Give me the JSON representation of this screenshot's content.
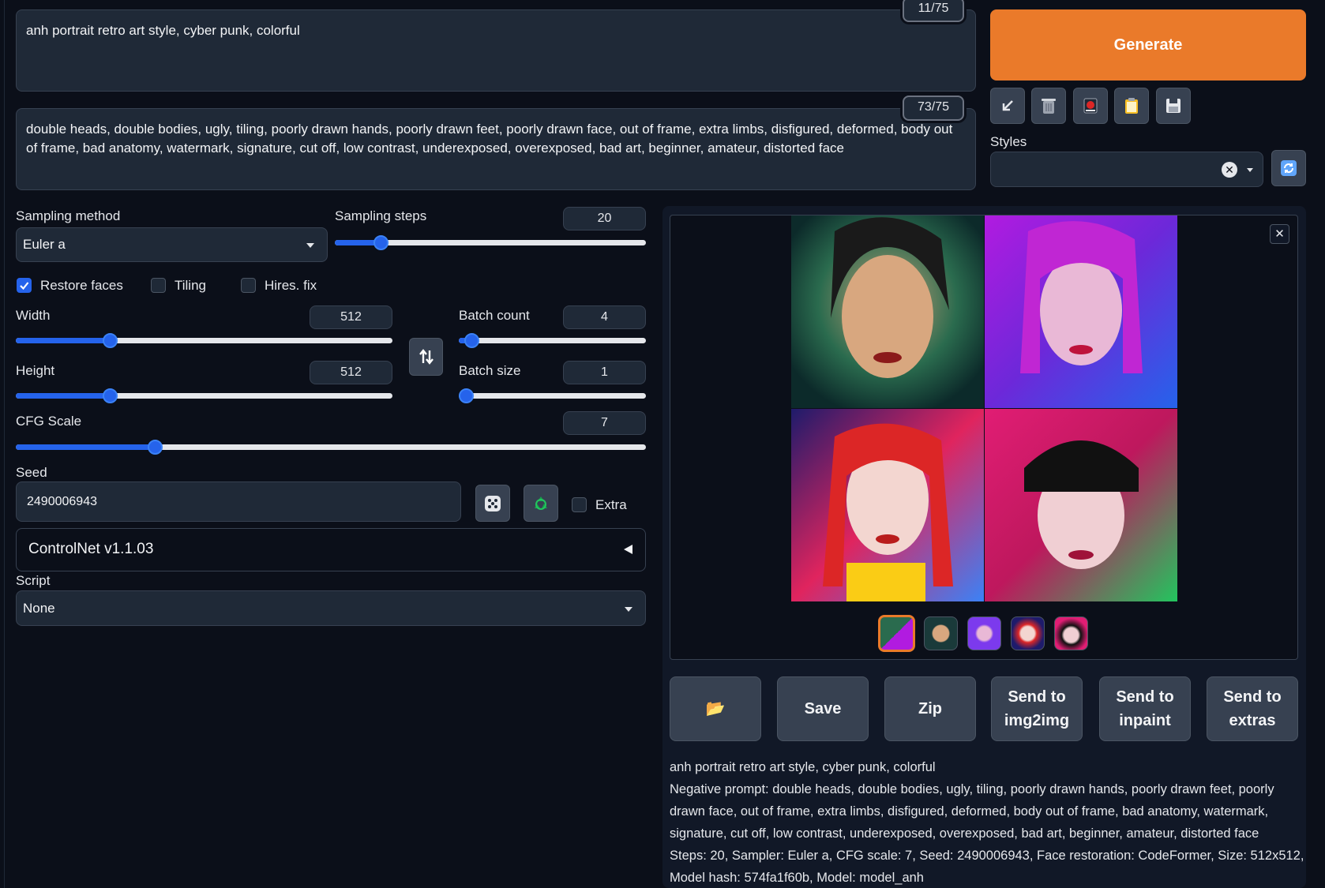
{
  "prompt": {
    "positive": "anh portrait retro art style, cyber punk, colorful",
    "positive_tokens": "11/75",
    "negative": "double heads, double bodies, ugly, tiling, poorly drawn hands, poorly drawn feet, poorly drawn face, out of frame, extra limbs, disfigured, deformed, body out of frame, bad anatomy, watermark, signature, cut off, low contrast, underexposed, overexposed, bad art, beginner, amateur, distorted face",
    "negative_tokens": "73/75"
  },
  "generate_label": "Generate",
  "styles_label": "Styles",
  "sampling": {
    "method_label": "Sampling method",
    "method_value": "Euler a",
    "steps_label": "Sampling steps",
    "steps_value": "20",
    "steps_fraction": 0.13
  },
  "checks": {
    "restore_faces": "Restore faces",
    "tiling": "Tiling",
    "hires_fix": "Hires. fix"
  },
  "width": {
    "label": "Width",
    "value": "512",
    "fraction": 0.24
  },
  "height": {
    "label": "Height",
    "value": "512",
    "fraction": 0.24
  },
  "batch_count": {
    "label": "Batch count",
    "value": "4",
    "fraction": 0.03
  },
  "batch_size": {
    "label": "Batch size",
    "value": "1",
    "fraction": 0.0
  },
  "cfg": {
    "label": "CFG Scale",
    "value": "7",
    "fraction": 0.214
  },
  "seed": {
    "label": "Seed",
    "value": "2490006943",
    "extra_label": "Extra"
  },
  "controlnet_label": "ControlNet v1.1.03",
  "script": {
    "label": "Script",
    "value": "None"
  },
  "buttons": {
    "folder": "📂",
    "save": "Save",
    "zip": "Zip",
    "send_img2img_1": "Send to",
    "send_img2img_2": "img2img",
    "send_inpaint_1": "Send to",
    "send_inpaint_2": "inpaint",
    "send_extras_1": "Send to",
    "send_extras_2": "extras"
  },
  "gen_info": {
    "line1": "anh portrait retro art style, cyber punk, colorful",
    "line2": "Negative prompt: double heads, double bodies, ugly, tiling, poorly drawn hands, poorly drawn feet, poorly",
    "line3": "drawn face, out of frame, extra limbs, disfigured, deformed, body out of frame, bad anatomy, watermark,",
    "line4": "signature, cut off, low contrast, underexposed, overexposed, bad art, beginner, amateur, distorted face",
    "line5": "Steps: 20, Sampler: Euler a, CFG scale: 7, Seed: 2490006943, Face restoration: CodeFormer, Size: 512x512,",
    "line6": "Model hash: 574fa1f60b, Model: model_anh"
  },
  "colors": {
    "accent": "#2563eb",
    "generate": "#ea7a2a",
    "background": "#0b0f19"
  }
}
